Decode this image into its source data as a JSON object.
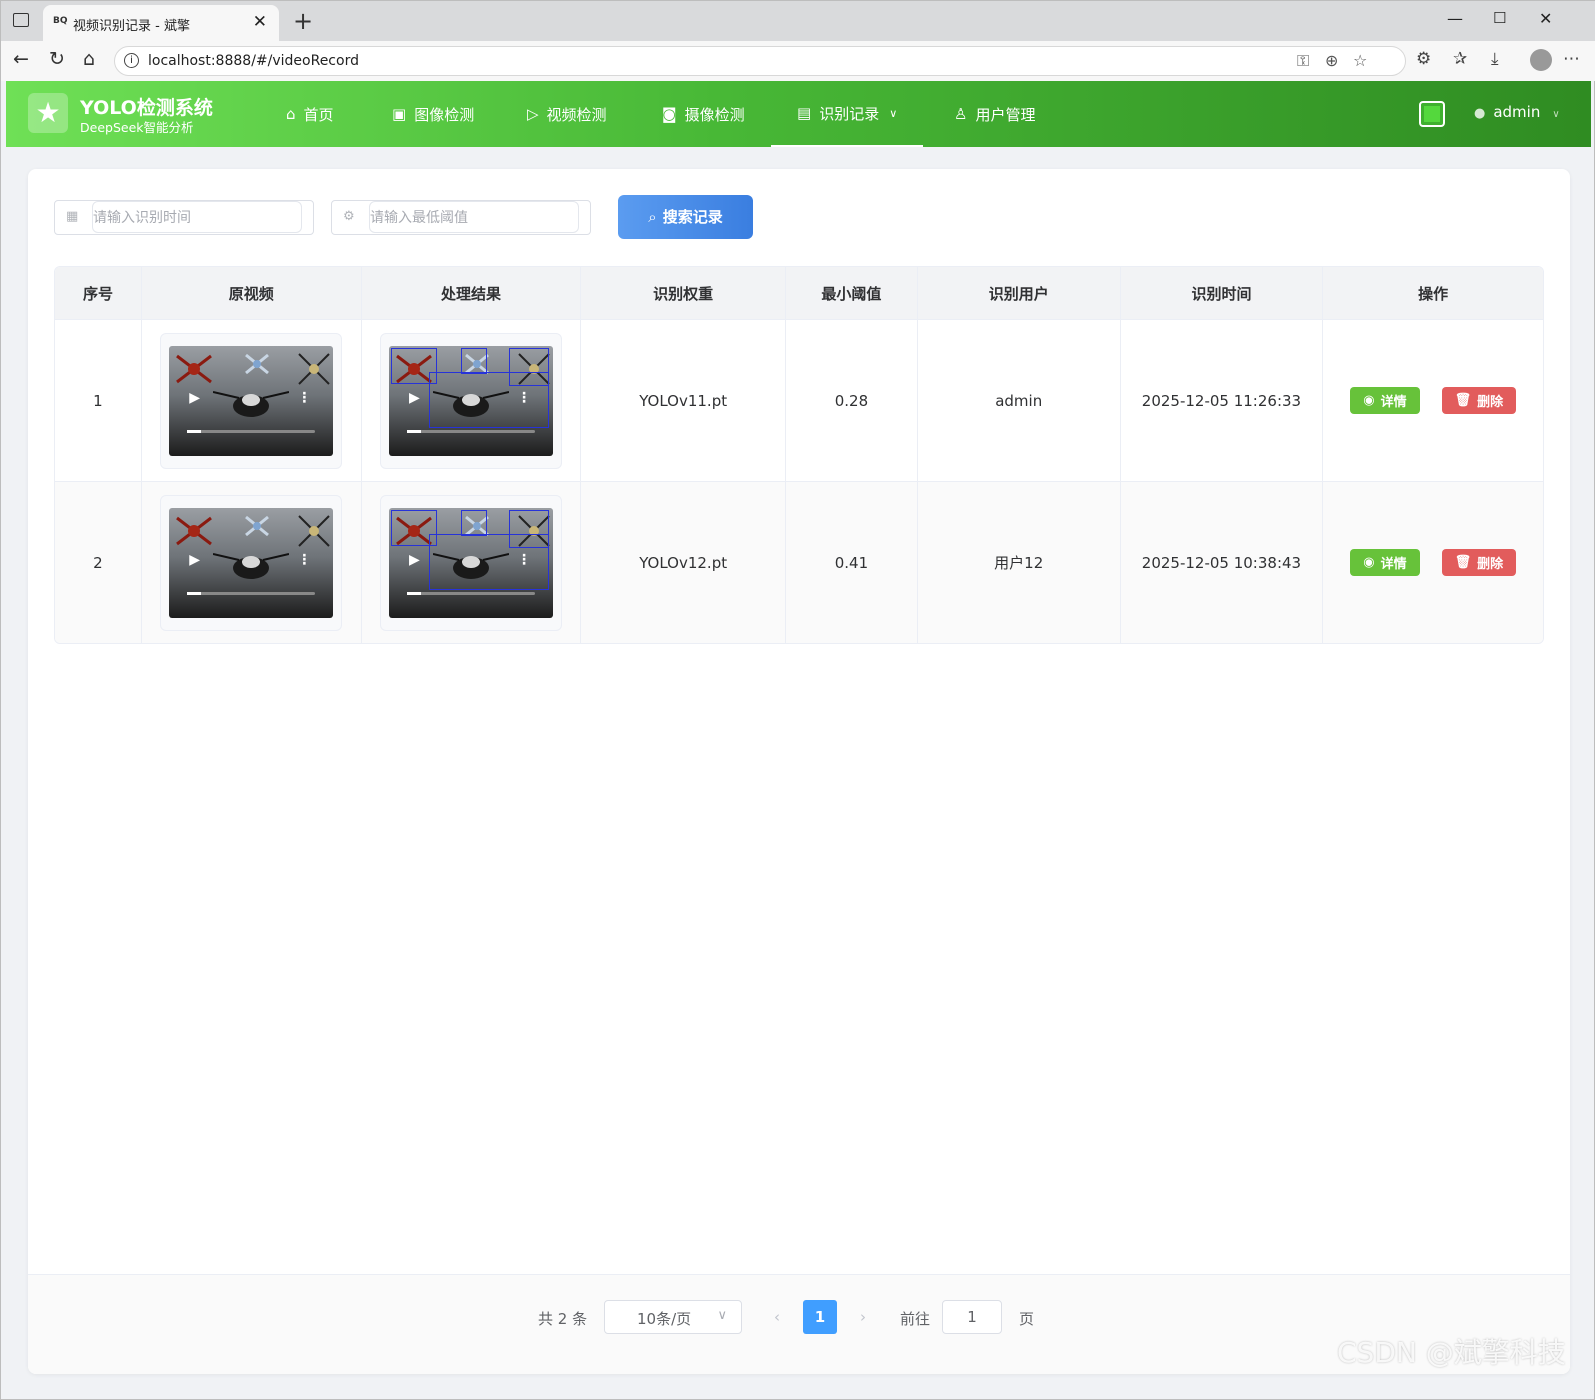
{
  "browser": {
    "tab_title": "视频识别记录 - 斌擎",
    "tab_favicon": "BQ",
    "url": "localhost:8888/#/videoRecord"
  },
  "app": {
    "brand": "YOLO检测系统",
    "subtitle": "DeepSeek智能分析",
    "nav": [
      {
        "label": "首页",
        "icon": "home-icon"
      },
      {
        "label": "图像检测",
        "icon": "image-icon"
      },
      {
        "label": "视频检测",
        "icon": "play-circle-icon"
      },
      {
        "label": "摄像检测",
        "icon": "camera-icon"
      },
      {
        "label": "识别记录",
        "icon": "document-icon",
        "active": true
      },
      {
        "label": "用户管理",
        "icon": "user-icon"
      }
    ],
    "username": "admin",
    "accent_color": "#67c23a",
    "primary_color": "#409eff"
  },
  "search": {
    "time_placeholder": "请输入识别时间",
    "threshold_placeholder": "请输入最低阈值",
    "button_label": "搜索记录"
  },
  "table": {
    "headers": [
      "序号",
      "原视频",
      "处理结果",
      "识别权重",
      "最小阈值",
      "识别用户",
      "识别时间",
      "操作"
    ],
    "rows": [
      {
        "index": "1",
        "weight": "YOLOv11.pt",
        "threshold": "0.28",
        "user": "admin",
        "time": "2025-12-05 11:26:33"
      },
      {
        "index": "2",
        "weight": "YOLOv12.pt",
        "threshold": "0.41",
        "user": "用户12",
        "time": "2025-12-05 10:38:43"
      }
    ],
    "detail_label": "详情",
    "delete_label": "删除"
  },
  "pagination": {
    "total": "共 2 条",
    "page_size": "10条/页",
    "current_page": "1",
    "goto_label": "前往",
    "goto_value": "1",
    "page_suffix": "页"
  },
  "watermark": "CSDN @斌擎科技"
}
